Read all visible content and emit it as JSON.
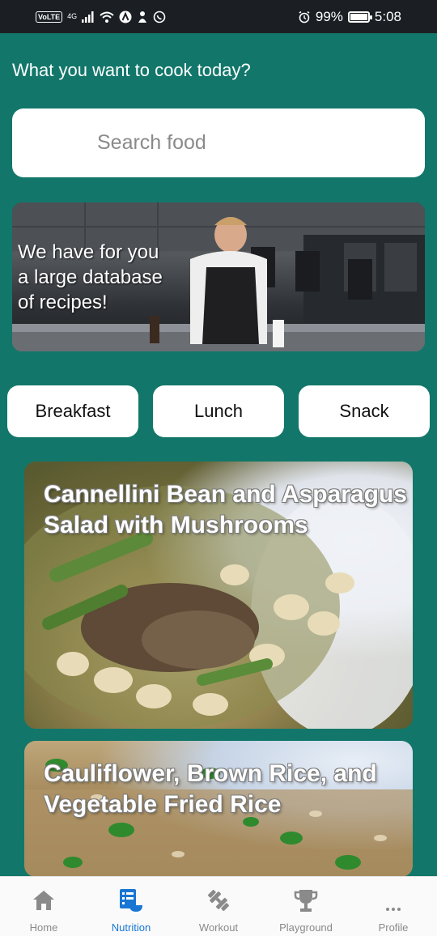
{
  "status_bar": {
    "volte": "VoLTE",
    "network": "4G",
    "battery_percent": "99%",
    "battery_level": 0.99,
    "time": "5:08"
  },
  "heading": "What you want to cook today?",
  "search": {
    "placeholder": "Search food"
  },
  "banner": {
    "lines": [
      "We have for you",
      "a large database",
      "of recipes!"
    ]
  },
  "categories": [
    {
      "label": "Breakfast"
    },
    {
      "label": "Lunch"
    },
    {
      "label": "Snack"
    }
  ],
  "recipes": [
    {
      "title_lines": [
        "Cannellini Bean and Asparagus",
        "Salad with Mushrooms"
      ]
    },
    {
      "title_lines": [
        "Cauliflower, Brown Rice, and",
        "Vegetable Fried Rice"
      ]
    }
  ],
  "nav": {
    "active": "Nutrition",
    "active_color": "#1976d2",
    "items": [
      {
        "label": "Home",
        "icon": "home-icon"
      },
      {
        "label": "Nutrition",
        "icon": "nutrition-icon"
      },
      {
        "label": "Workout",
        "icon": "dumbbell-icon"
      },
      {
        "label": "Playground",
        "icon": "trophy-icon"
      },
      {
        "label": "Profile",
        "icon": "more-icon"
      }
    ]
  },
  "colors": {
    "background": "#12776a",
    "status_bar": "#1b1f24",
    "card": "#ffffff"
  }
}
